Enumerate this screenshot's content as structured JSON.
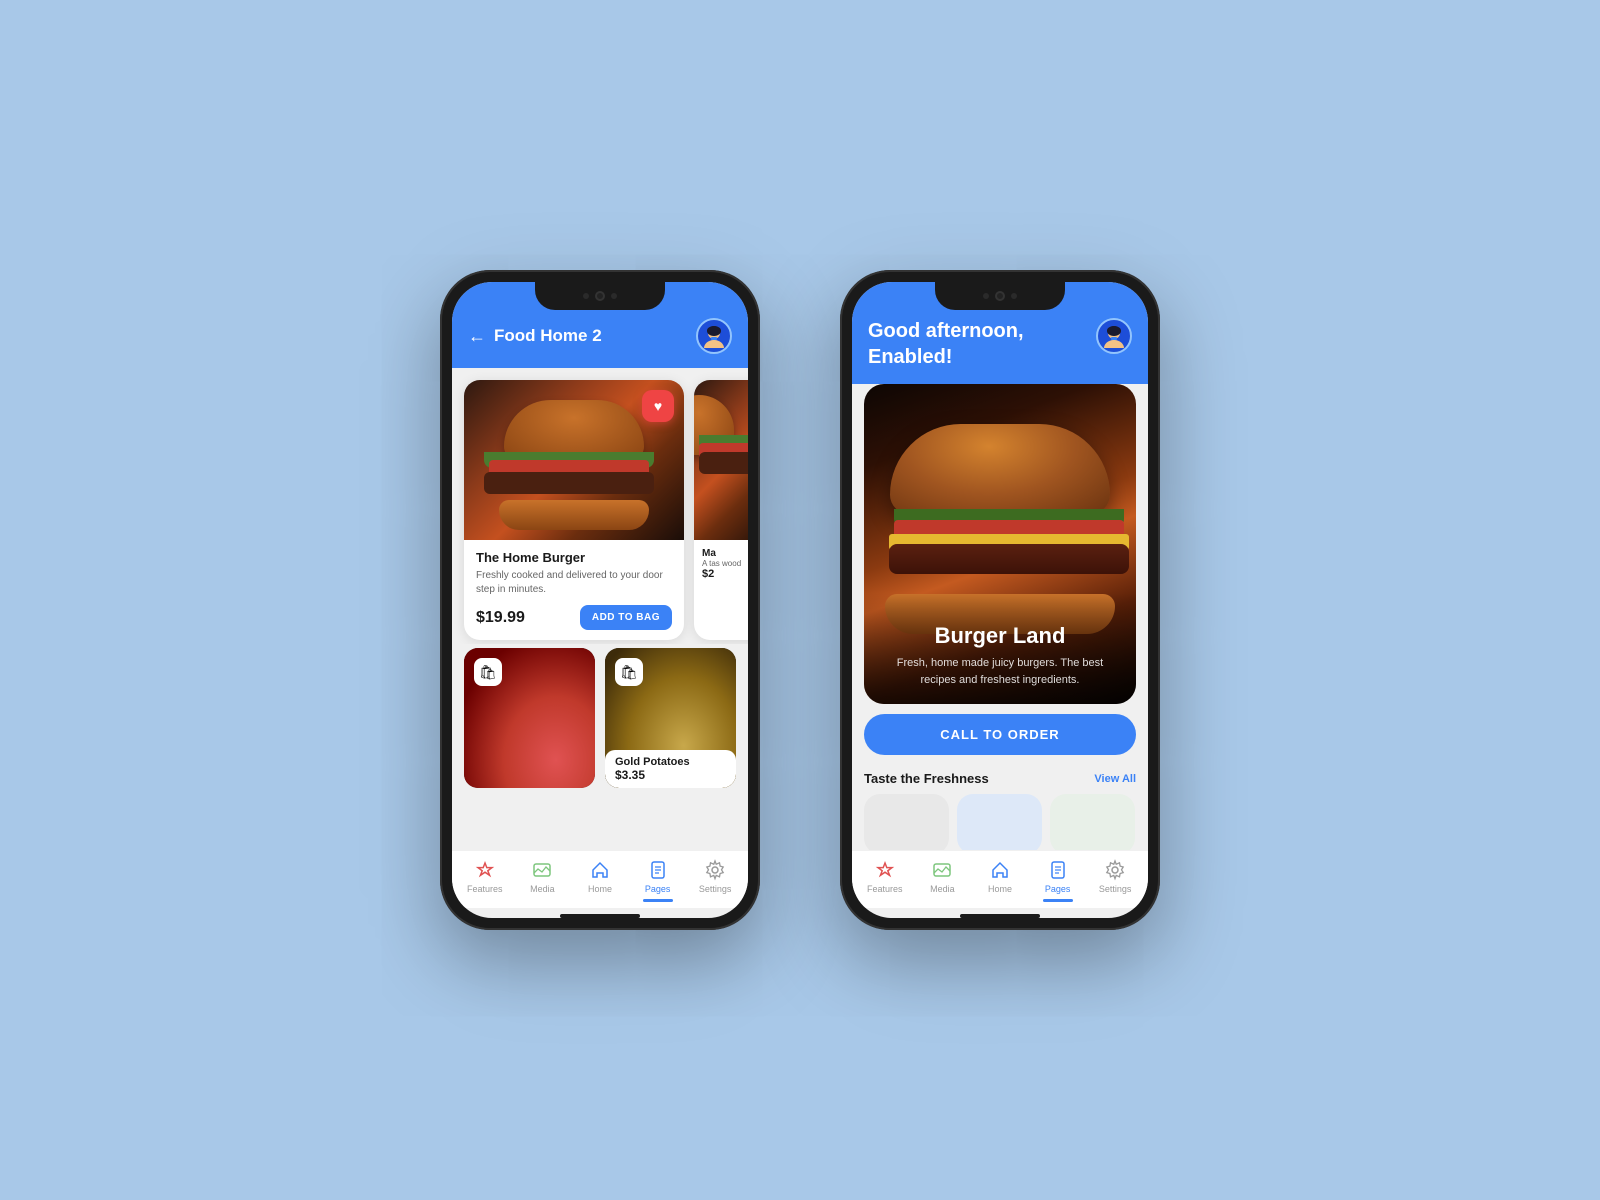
{
  "background": "#a8c8e8",
  "phone1": {
    "header": {
      "title": "Food Home 2",
      "back_label": "←"
    },
    "main_card": {
      "name": "The Home Burger",
      "description": "Freshly cooked and delivered to your door step in minutes.",
      "price": "$19.99",
      "add_to_bag": "ADD TO BAG"
    },
    "secondary_card": {
      "name": "Ma",
      "description": "A tas wood",
      "price": "$2"
    },
    "product1": {
      "name": "",
      "price": ""
    },
    "product2": {
      "name": "Gold Potatoes",
      "price": "$3.35"
    }
  },
  "phone2": {
    "greeting": "Good afternoon,\nEnabled!",
    "hero": {
      "title": "Burger Land",
      "subtitle": "Fresh, home made juicy burgers. The best recipes\nand freshest ingredients.",
      "cta": "CALL TO ORDER"
    },
    "freshness": {
      "title": "Taste the Freshness",
      "view_all": "View All"
    }
  },
  "nav": {
    "items": [
      {
        "label": "Features",
        "icon": "heart"
      },
      {
        "label": "Media",
        "icon": "image"
      },
      {
        "label": "Home",
        "icon": "home"
      },
      {
        "label": "Pages",
        "icon": "page",
        "active": true
      },
      {
        "label": "Settings",
        "icon": "gear"
      }
    ]
  },
  "icons": {
    "heart": "♥",
    "bag": "🛍",
    "back_arrow": "←",
    "view_all": "View All"
  }
}
